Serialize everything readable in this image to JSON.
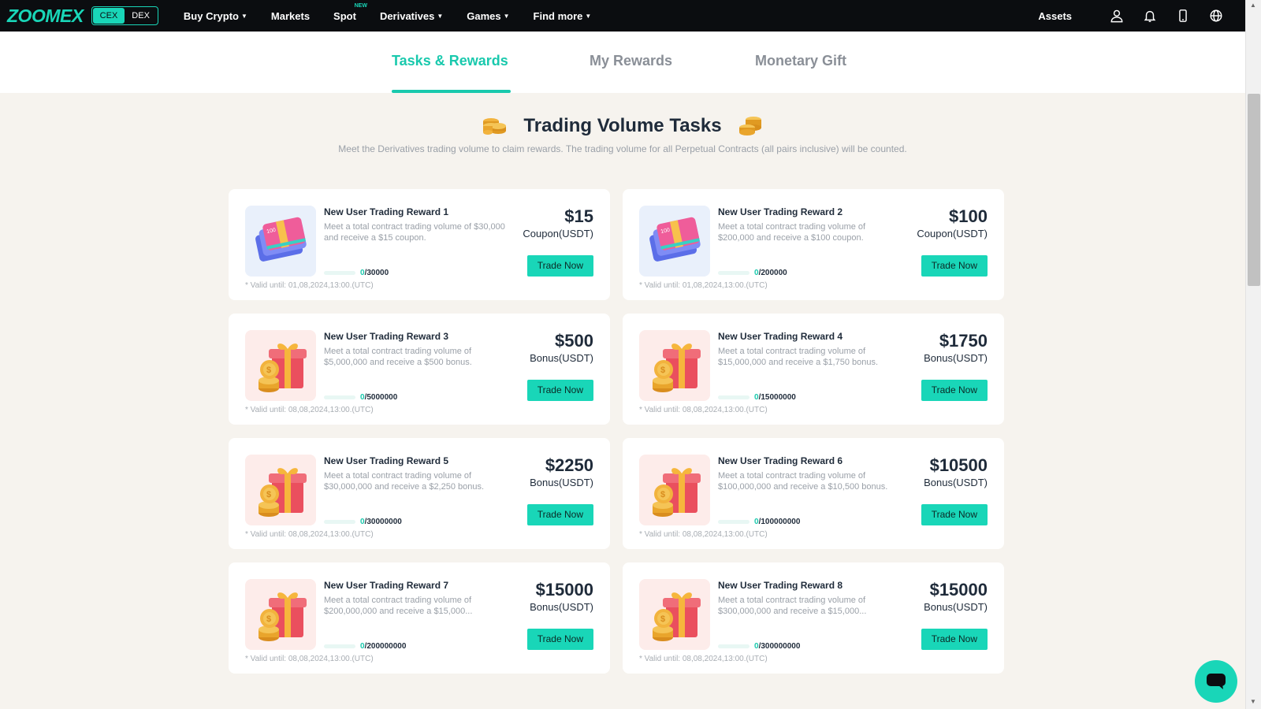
{
  "nav": {
    "logo": "ZOOMEX",
    "cex": "CEX",
    "dex": "DEX",
    "items": [
      {
        "label": "Buy Crypto",
        "caret": true
      },
      {
        "label": "Markets",
        "caret": false
      },
      {
        "label": "Spot",
        "caret": false,
        "badge": "NEW"
      },
      {
        "label": "Derivatives",
        "caret": true
      },
      {
        "label": "Games",
        "caret": true
      },
      {
        "label": "Find more",
        "caret": true
      }
    ],
    "assets": "Assets",
    "icons": [
      "user-icon",
      "bell-icon",
      "mobile-icon",
      "globe-icon"
    ]
  },
  "tabs": [
    {
      "label": "Tasks & Rewards",
      "active": true
    },
    {
      "label": "My Rewards",
      "active": false
    },
    {
      "label": "Monetary Gift",
      "active": false
    }
  ],
  "section": {
    "title": "Trading Volume Tasks",
    "subtitle": "Meet the Derivatives trading volume to claim rewards. The trading volume for all Perpetual Contracts (all pairs inclusive) will be counted."
  },
  "cards": [
    {
      "title": "New User Trading Reward 1",
      "desc": "Meet a total contract trading volume of $30,000 and receive a $15 coupon.",
      "current": "0",
      "target": "/30000",
      "valid": "* Valid until: 01,08,2024,13:00.(UTC)",
      "amount": "$15",
      "unit": "Coupon(USDT)",
      "button": "Trade Now",
      "image": "coupon-icon"
    },
    {
      "title": "New User Trading Reward 2",
      "desc": "Meet a total contract trading volume of $200,000 and receive a $100 coupon.",
      "current": "0",
      "target": "/200000",
      "valid": "* Valid until: 01,08,2024,13:00.(UTC)",
      "amount": "$100",
      "unit": "Coupon(USDT)",
      "button": "Trade Now",
      "image": "coupon-icon"
    },
    {
      "title": "New User Trading Reward 3",
      "desc": "Meet a total contract trading volume of $5,000,000 and receive a $500 bonus.",
      "current": "0",
      "target": "/5000000",
      "valid": "* Valid until: 08,08,2024,13:00.(UTC)",
      "amount": "$500",
      "unit": "Bonus(USDT)",
      "button": "Trade Now",
      "image": "gift-icon"
    },
    {
      "title": "New User Trading Reward 4",
      "desc": "Meet a total contract trading volume of $15,000,000 and receive a $1,750 bonus.",
      "current": "0",
      "target": "/15000000",
      "valid": "* Valid until: 08,08,2024,13:00.(UTC)",
      "amount": "$1750",
      "unit": "Bonus(USDT)",
      "button": "Trade Now",
      "image": "gift-icon"
    },
    {
      "title": "New User Trading Reward 5",
      "desc": "Meet a total contract trading volume of $30,000,000 and receive a $2,250 bonus.",
      "current": "0",
      "target": "/30000000",
      "valid": "* Valid until: 08,08,2024,13:00.(UTC)",
      "amount": "$2250",
      "unit": "Bonus(USDT)",
      "button": "Trade Now",
      "image": "gift-icon"
    },
    {
      "title": "New User Trading Reward 6",
      "desc": "Meet a total contract trading volume of $100,000,000 and receive a $10,500 bonus.",
      "current": "0",
      "target": "/100000000",
      "valid": "* Valid until: 08,08,2024,13:00.(UTC)",
      "amount": "$10500",
      "unit": "Bonus(USDT)",
      "button": "Trade Now",
      "image": "gift-icon"
    },
    {
      "title": "New User Trading Reward 7",
      "desc": "Meet a total contract trading volume of $200,000,000 and receive a $15,000...",
      "current": "0",
      "target": "/200000000",
      "valid": "* Valid until: 08,08,2024,13:00.(UTC)",
      "amount": "$15000",
      "unit": "Bonus(USDT)",
      "button": "Trade Now",
      "image": "gift-icon"
    },
    {
      "title": "New User Trading Reward 8",
      "desc": "Meet a total contract trading volume of $300,000,000 and receive a $15,000...",
      "current": "0",
      "target": "/300000000",
      "valid": "* Valid until: 08,08,2024,13:00.(UTC)",
      "amount": "$15000",
      "unit": "Bonus(USDT)",
      "button": "Trade Now",
      "image": "gift-icon"
    }
  ],
  "colors": {
    "accent": "#19d6b8",
    "nav_bg": "#0b0d10",
    "page_bg": "#f6f3ee",
    "text_dark": "#1f2b3a",
    "text_muted": "#9aa0a8"
  },
  "chat": {
    "icon": "chat-icon"
  }
}
